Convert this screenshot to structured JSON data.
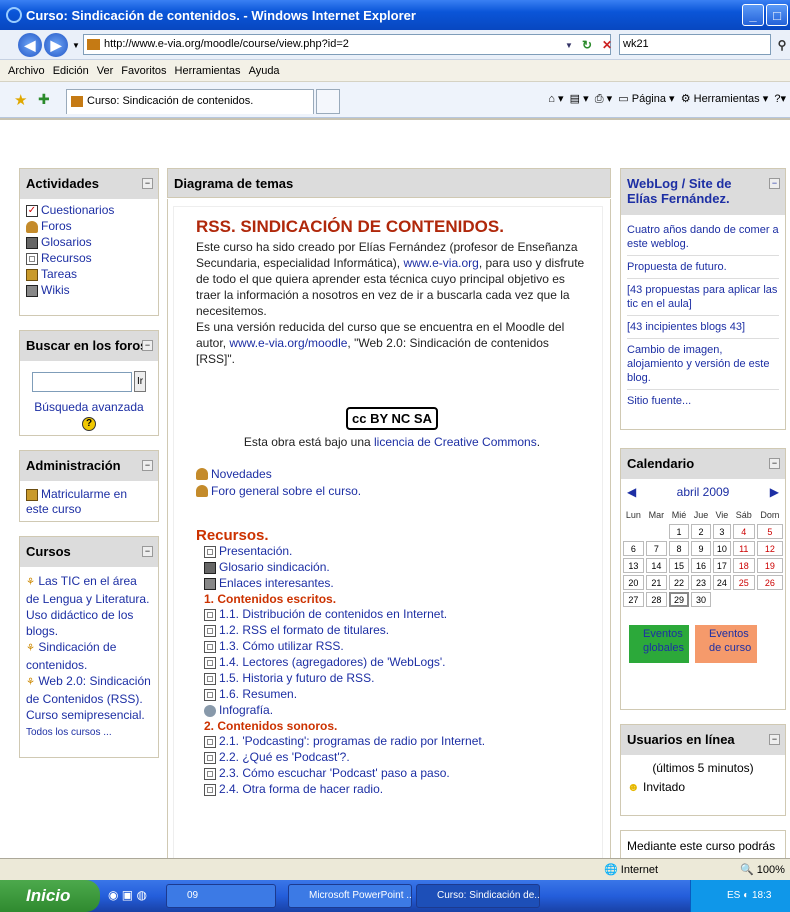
{
  "window": {
    "title": "Curso: Sindicación de contenidos. - Windows Internet Explorer"
  },
  "address": {
    "url": "http://www.e-via.org/moodle/course/view.php?id=2",
    "search": "wk21"
  },
  "menu": [
    "Archivo",
    "Edición",
    "Ver",
    "Favoritos",
    "Herramientas",
    "Ayuda"
  ],
  "tab": {
    "label": "Curso: Sindicación de contenidos."
  },
  "commands": [
    "Página",
    "Herramientas"
  ],
  "left": {
    "actividades": {
      "title": "Actividades",
      "items": [
        "Cuestionarios",
        "Foros",
        "Glosarios",
        "Recursos",
        "Tareas",
        "Wikis"
      ]
    },
    "buscar": {
      "title": "Buscar en los foros",
      "go": "Ir",
      "advanced": "Búsqueda avanzada"
    },
    "admin": {
      "title": "Administración",
      "item": "Matricularme en este curso"
    },
    "cursos": {
      "title": "Cursos",
      "items": [
        "Las TIC en el área de Lengua y Literatura. Uso didáctico de los blogs.",
        "Sindicación de contenidos.",
        "Web 2.0: Sindicación de Contenidos (RSS). Curso semipresencial."
      ],
      "all": "Todos los cursos ..."
    }
  },
  "main": {
    "head": "Diagrama de temas",
    "title": "RSS. SINDICACIÓN DE CONTENIDOS.",
    "p1a": "Este curso ha sido creado por Elías Fernández (profesor de Enseñanza Secundaria, especialidad Informática), ",
    "p1link": "www.e-via.org",
    "p1b": ", para uso y disfrute de todo el que quiera aprender esta técnica cuyo principal objetivo es traer la información a nosotros en vez de ir a buscarla cada vez que la necesitemos.",
    "p2a": "Es una versión reducida del curso que se encuentra en el Moodle del autor, ",
    "p2link": "www.e-via.org/moodle",
    "p2b": ", \"Web 2.0: Sindicación de contenidos [RSS]\".",
    "cc_logo": "cc BY NC SA",
    "license_a": "Esta obra está bajo una ",
    "license_link": "licencia de Creative Commons",
    "license_b": ".",
    "forums": [
      "Novedades",
      "Foro general sobre el curso."
    ],
    "recursos_title": "Recursos.",
    "recursos": [
      "Presentación.",
      "Glosario sindicación.",
      "Enlaces interesantes."
    ],
    "sec1": "1. Contenidos escritos.",
    "sec1_items": [
      "1.1. Distribución de contenidos en Internet.",
      "1.2. RSS el formato de titulares.",
      "1.3. Cómo utilizar RSS.",
      "1.4. Lectores (agregadores) de 'WebLogs'.",
      "1.5. Historia y futuro de RSS.",
      "1.6. Resumen."
    ],
    "infografia": "Infografía.",
    "sec2": "2. Contenidos sonoros.",
    "sec2_items": [
      "2.1. 'Podcasting': programas de radio por Internet.",
      "2.2. ¿Qué es 'Podcast'?.",
      "2.3. Cómo escuchar 'Podcast' paso a paso.",
      "2.4. Otra forma de hacer radio."
    ]
  },
  "right": {
    "weblog": {
      "title": "WebLog / Site de Elías Fernández.",
      "items": [
        "Cuatro años dando de comer a este weblog.",
        "Propuesta de futuro.",
        "[43 propuestas para aplicar las tic en el aula]",
        "[43 incipientes blogs 43]",
        "Cambio de imagen, alojamiento y versión de este blog.",
        "Sitio fuente..."
      ]
    },
    "cal": {
      "title": "Calendario",
      "month": "abril 2009",
      "days": [
        "Lun",
        "Mar",
        "Mié",
        "Jue",
        "Vie",
        "Sáb",
        "Dom"
      ],
      "weeks": [
        [
          "",
          "",
          "1",
          "2",
          "3",
          "4",
          "5"
        ],
        [
          "6",
          "7",
          "8",
          "9",
          "10",
          "11",
          "12"
        ],
        [
          "13",
          "14",
          "15",
          "16",
          "17",
          "18",
          "19"
        ],
        [
          "20",
          "21",
          "22",
          "23",
          "24",
          "25",
          "26"
        ],
        [
          "27",
          "28",
          "29",
          "30",
          "",
          "",
          ""
        ]
      ],
      "ev_global": "Eventos globales",
      "ev_curso": "Eventos de curso"
    },
    "users": {
      "title": "Usuarios en línea",
      "sub": "(últimos 5 minutos)",
      "user": "Invitado"
    },
    "more": "Mediante este curso podrás"
  },
  "status": {
    "zone": "Internet",
    "zoom": "100%"
  },
  "taskbar": {
    "start": "Inicio",
    "tasks": [
      "09",
      "Microsoft PowerPoint ...",
      "Curso: Sindicación de..."
    ],
    "lang": "ES",
    "time": "18:3"
  }
}
